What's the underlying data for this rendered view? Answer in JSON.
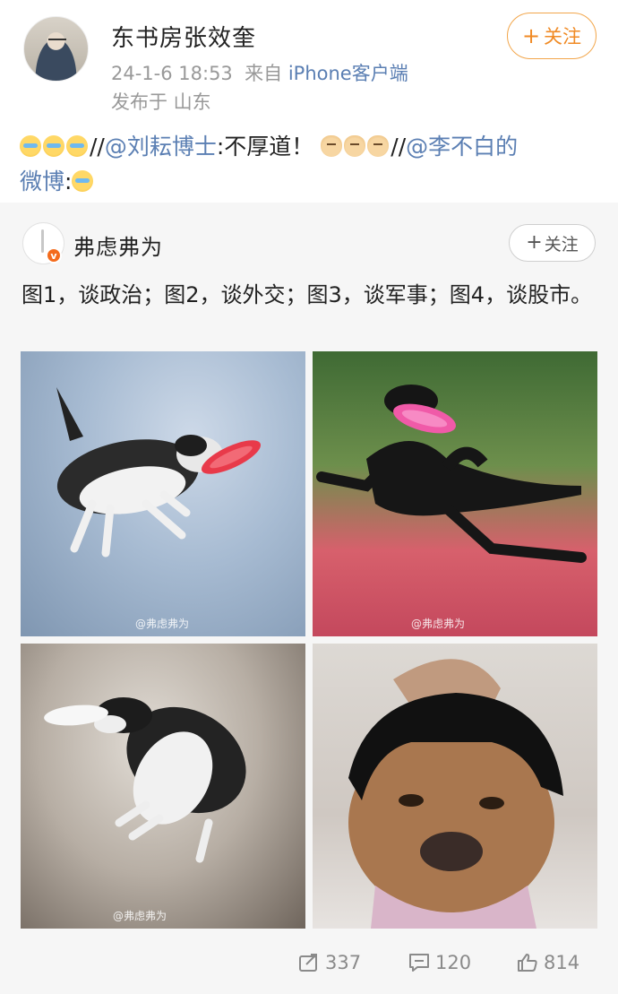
{
  "post": {
    "author_name": "东书房张效奎",
    "time": "24-1-6 18:53",
    "source_prefix": "来自",
    "source": "iPhone客户端",
    "location": "发布于 山东",
    "follow_label": "关注",
    "repost_text": {
      "sep1": "//",
      "mention1": "@刘耘博士",
      "text1": ":不厚道！",
      "sep2": "//",
      "mention2": "@李不白的",
      "mention2_cont": "微博",
      "text2": ":"
    }
  },
  "original": {
    "author_name": "弗虑弗为",
    "verified_badge": "v",
    "follow_label": "关注",
    "text": "图1，谈政治；图2，谈外交；图3，谈军事；图4，谈股市。",
    "images": [
      {
        "subject": "border collie catching red frisbee",
        "watermark": "@弗虑弗为"
      },
      {
        "subject": "black dog catching pink frisbee",
        "watermark": "@弗虑弗为"
      },
      {
        "subject": "border collie catching white frisbee",
        "watermark": "@弗虑弗为"
      },
      {
        "subject": "bulldog wearing black wig",
        "watermark": ""
      }
    ]
  },
  "stats": {
    "reposts": "337",
    "comments": "120",
    "likes": "814"
  },
  "icons": {
    "repost": "repost-icon",
    "comment": "comment-icon",
    "like": "like-icon"
  },
  "colors": {
    "link": "#5b7fb3",
    "follow_accent": "#f08a24",
    "card_bg": "#f6f6f6"
  }
}
